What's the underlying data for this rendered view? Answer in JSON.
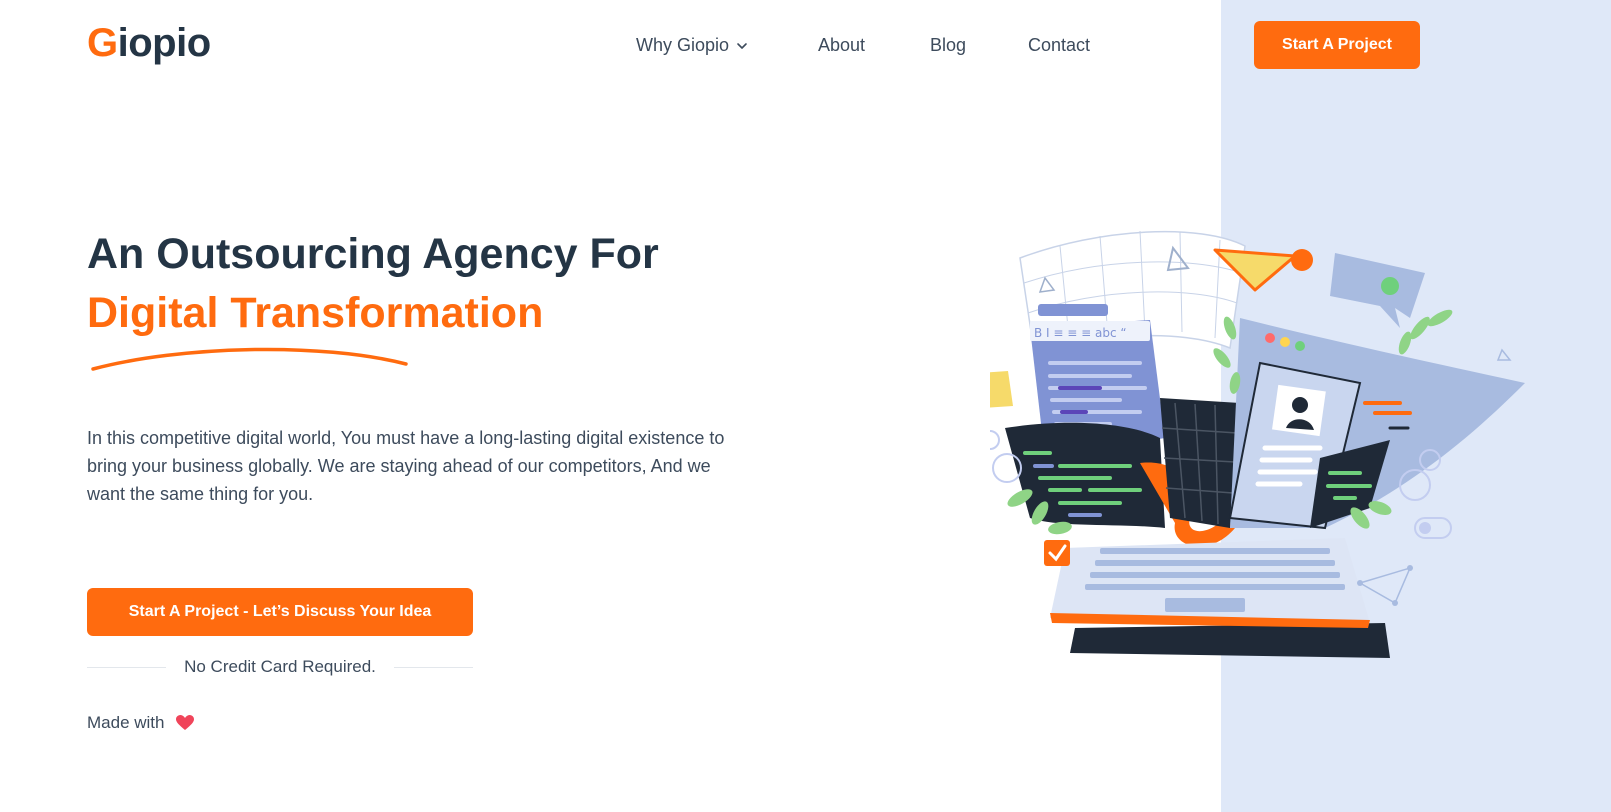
{
  "header": {
    "logo_first": "G",
    "logo_rest": "iopio",
    "nav": [
      {
        "label": "Why Giopio",
        "has_dropdown": true
      },
      {
        "label": "About"
      },
      {
        "label": "Blog"
      },
      {
        "label": "Contact"
      }
    ],
    "cta_label": "Start A Project"
  },
  "hero": {
    "title_line1": "An Outsourcing Agency For",
    "title_line2": "Digital Transformation",
    "description": "In this competitive digital world, You must have a long-lasting digital existence to bring your business globally. We are staying ahead of our competitors, And we want the same thing for you.",
    "cta_label": "Start A Project - Let’s Discuss Your Idea",
    "no_credit_card": "No Credit Card Required.",
    "made_with": "Made with"
  },
  "icons": {
    "nav_dropdown": "chevron-down-icon",
    "made_with": "heart-icon"
  },
  "colors": {
    "accent": "#ff6b0f",
    "heading": "#243545",
    "panel": "#dfe8f8",
    "heart": "#f0445a"
  }
}
